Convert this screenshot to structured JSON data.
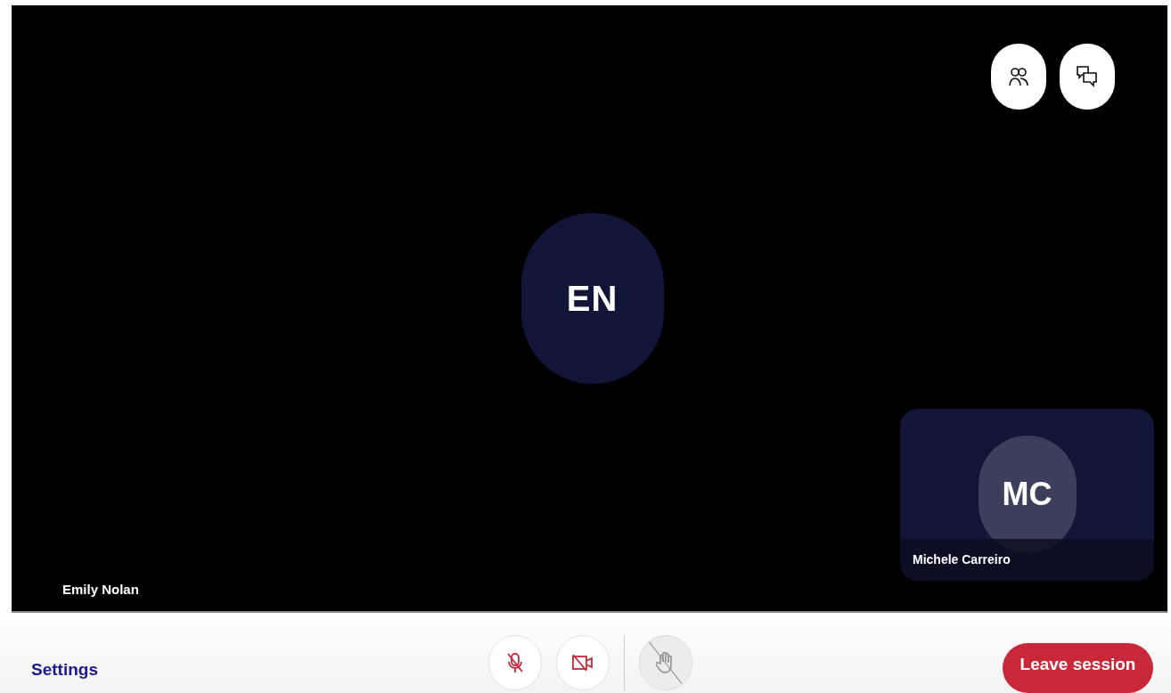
{
  "stage": {
    "speaker": {
      "initials": "EN",
      "name": "Emily Nolan"
    },
    "self_view": {
      "initials": "MC",
      "name": "Michele Carreiro"
    },
    "top_buttons": [
      {
        "kind": "participants"
      },
      {
        "kind": "chat"
      }
    ]
  },
  "toolbar": {
    "settings": "Settings",
    "controls": [
      {
        "kind": "mic",
        "muted": true
      },
      {
        "kind": "camera",
        "on": false
      },
      {
        "kind": "hand",
        "disabled": true
      }
    ],
    "leave": "Leave session"
  }
}
